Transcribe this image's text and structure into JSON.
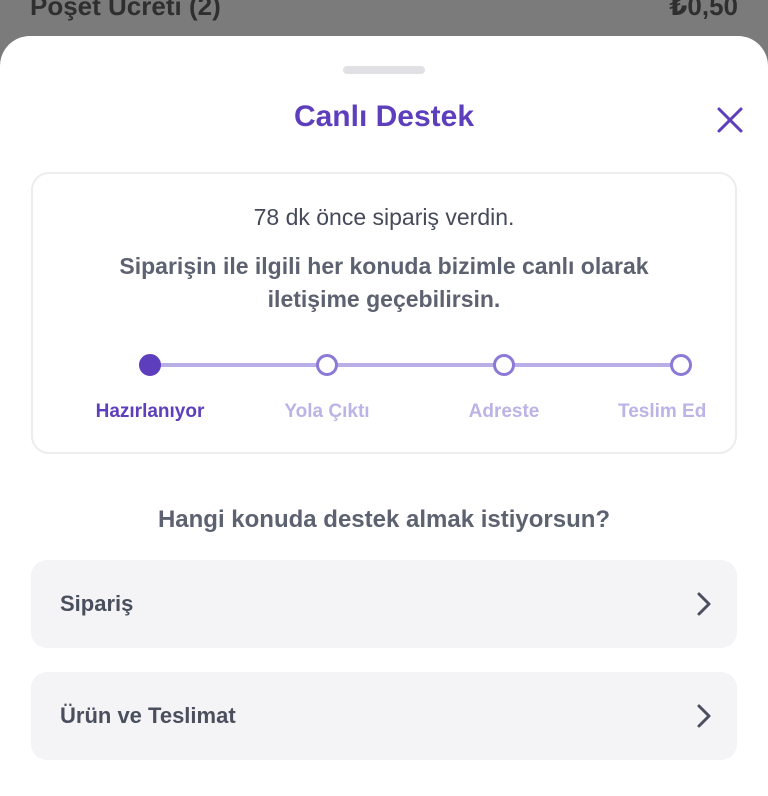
{
  "background": {
    "row_label": "Poşet Ücreti (2)",
    "row_value": "₺0,50"
  },
  "sheet": {
    "title": "Canlı Destek",
    "close_icon": "close-icon"
  },
  "order_card": {
    "ordered_text": "78 dk önce sipariş verdin.",
    "description": "Siparişin ile ilgili her konuda bizimle canlı olarak iletişime geçebilirsin.",
    "steps": [
      {
        "label": "Hazırlanıyor",
        "active": true
      },
      {
        "label": "Yola Çıktı",
        "active": false
      },
      {
        "label": "Adreste",
        "active": false
      },
      {
        "label": "Teslim Ed",
        "active": false
      }
    ]
  },
  "support": {
    "question": "Hangi konuda destek almak istiyorsun?",
    "options": [
      {
        "label": "Sipariş",
        "icon": "chevron-right-icon"
      },
      {
        "label": "Ürün ve Teslimat",
        "icon": "chevron-right-icon"
      }
    ]
  },
  "colors": {
    "brand": "#5d3ebc",
    "inactive_step": "#bcb3e6",
    "option_bg": "#f4f4f6"
  }
}
